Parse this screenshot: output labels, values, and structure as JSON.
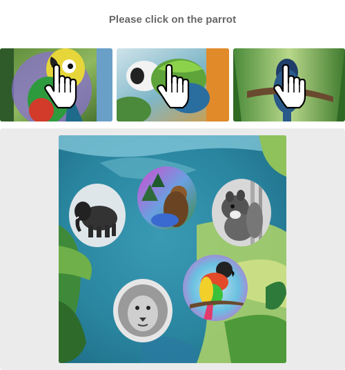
{
  "instruction": "Please click on the parrot",
  "examples": [
    {
      "subject": "parrot",
      "icon": "pointing-hand-cursor-icon"
    },
    {
      "subject": "parrot",
      "icon": "pointing-hand-cursor-icon"
    },
    {
      "subject": "parrot",
      "icon": "pointing-hand-cursor-icon"
    }
  ],
  "puzzle": {
    "target": "parrot",
    "animals": [
      "elephant",
      "bear",
      "squirrel",
      "parrot",
      "lion"
    ]
  },
  "colors": {
    "instruction_text": "#666666",
    "panel_background": "#ebebeb",
    "water_teal": "#2f8fa6",
    "leaf_green": "#8cbf4a"
  }
}
